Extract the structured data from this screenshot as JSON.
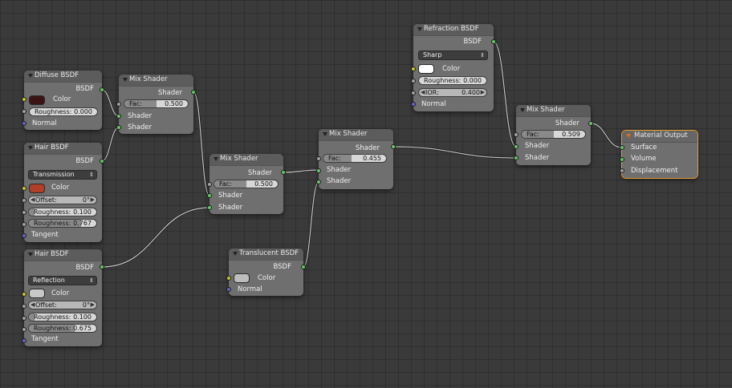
{
  "colors": {
    "socket_shader": "#63c763",
    "socket_color": "#c7c729",
    "socket_value": "#a1a1a1",
    "socket_vector": "#6363c7",
    "diffuse_color": "#3a1414",
    "hair1_color": "#b03e28",
    "hair2_color": "#c8c8c8",
    "refraction_color": "#ffffff",
    "translucent_color": "#bdbdbd",
    "active_outline": "#e59a30"
  },
  "nodes": {
    "diffuse": {
      "title": "Diffuse BSDF",
      "out": "BSDF",
      "color_label": "Color",
      "roughness_label": "Roughness:",
      "roughness_value": "0.000",
      "normal_label": "Normal"
    },
    "hair1": {
      "title": "Hair BSDF",
      "out": "BSDF",
      "component": "Transmission",
      "color_label": "Color",
      "offset_label": "Offset:",
      "offset_value": "0°",
      "rough1_label": "Roughness:",
      "rough1_value": "0.100",
      "rough2_label": "Roughness:",
      "rough2_value": "0.767",
      "tangent_label": "Tangent"
    },
    "hair2": {
      "title": "Hair BSDF",
      "out": "BSDF",
      "component": "Reflection",
      "color_label": "Color",
      "offset_label": "Offset:",
      "offset_value": "0°",
      "rough1_label": "Roughness:",
      "rough1_value": "0.100",
      "rough2_label": "Roughness:",
      "rough2_value": "0.675",
      "tangent_label": "Tangent"
    },
    "mix1": {
      "title": "Mix Shader",
      "out": "Shader",
      "fac_label": "Fac:",
      "fac_value": "0.500",
      "fac_fraction": 0.5,
      "in1": "Shader",
      "in2": "Shader"
    },
    "mix2": {
      "title": "Mix Shader",
      "out": "Shader",
      "fac_label": "Fac:",
      "fac_value": "0.500",
      "fac_fraction": 0.5,
      "in1": "Shader",
      "in2": "Shader"
    },
    "mix3": {
      "title": "Mix Shader",
      "out": "Shader",
      "fac_label": "Fac:",
      "fac_value": "0.455",
      "fac_fraction": 0.455,
      "in1": "Shader",
      "in2": "Shader"
    },
    "mix4": {
      "title": "Mix Shader",
      "out": "Shader",
      "fac_label": "Fac:",
      "fac_value": "0.509",
      "fac_fraction": 0.509,
      "in1": "Shader",
      "in2": "Shader"
    },
    "refraction": {
      "title": "Refraction BSDF",
      "out": "BSDF",
      "distribution": "Sharp",
      "color_label": "Color",
      "roughness_label": "Roughness:",
      "roughness_value": "0.000",
      "ior_label": "IOR:",
      "ior_value": "0.400",
      "normal_label": "Normal"
    },
    "translucent": {
      "title": "Translucent BSDF",
      "out": "BSDF",
      "color_label": "Color",
      "normal_label": "Normal"
    },
    "output": {
      "title": "Material Output",
      "surface": "Surface",
      "volume": "Volume",
      "displacement": "Displacement"
    }
  },
  "icons": {
    "collapse": "collapse-triangle-icon",
    "dropdown": "up-down-arrows-icon",
    "output": "output-triangle-icon"
  }
}
